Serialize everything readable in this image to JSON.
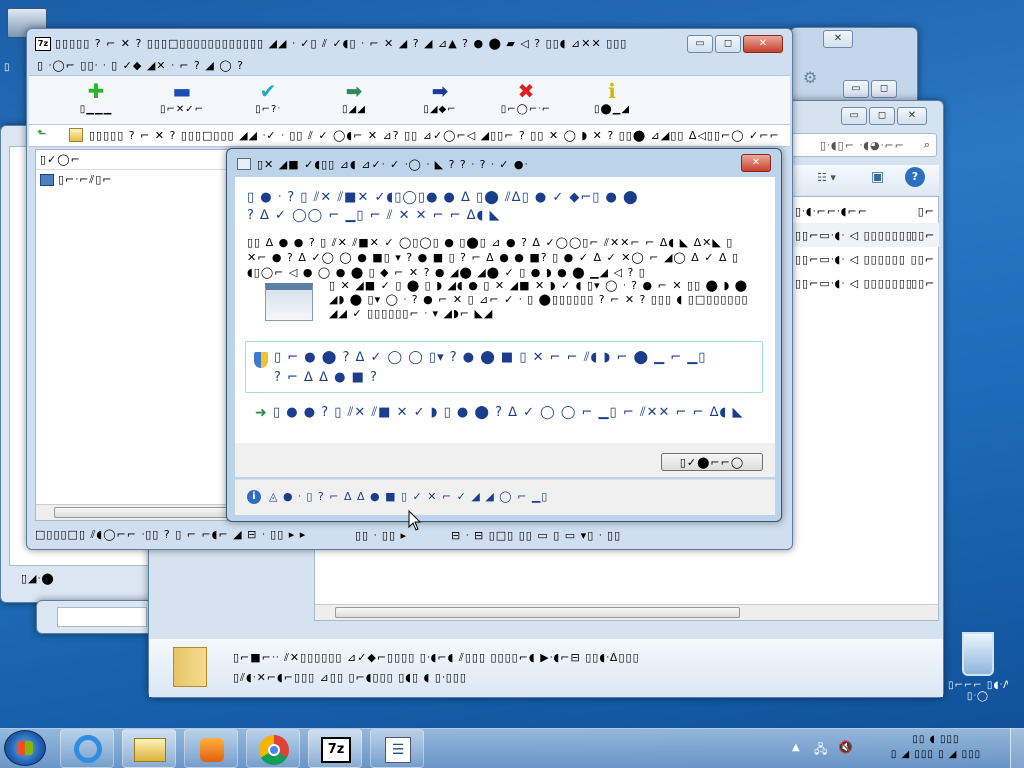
{
  "desktop": {
    "top_icon_label": "▯",
    "recycle_bin_label": "▯⌐⌐⌐ ▯◖ᐧᐱ▯",
    "recycle_bin_sub": "▯ᐧ◯"
  },
  "explorer_back": {
    "search": "▯ᐧ◖▯⌐ ᐧ◖◕ᐧ⌐⌐",
    "rows": [
      [
        "▯ᐧ◖ᐧ⌐⌐ᐧ◖⌐⌐",
        "▯⌐"
      ],
      [
        "▯▯⌐▭ᐧ◖ᐧ ◁ ▯▯▯▯▯▯▯",
        "▯▯⌐"
      ],
      [
        "▯▯⌐▭ᐧ◖ᐧ ◁ ▯▯▯▯▯▯",
        "▯▯⌐"
      ],
      [
        "▯▯⌐▭ᐧ◖ᐧ ◁ ▯▯▯▯▯▯▯",
        "▯▯⌐"
      ]
    ],
    "detail_line1": "▯⌐■⌐ᐧᐧ ⫽✕▯▯▯▯▯▯ ⊿✓◆⌐▯▯▯▯ ▯ᐧ◖⌐◖ ⫽▯▯▯ ▯▯▯▯⌐◖ ▶ᐧ◖⌐⊟ ▯▯◖ᐧᐃ▯▯▯",
    "detail_line2": "▯⫽◖ᐧ✕⌐◖⌐▯▯▯ ⊿▯▯ ▯⌐◖▯▯▯ ▯◖▯ ◖ ▯ᐧ▯▯▯",
    "left_label": "▯◢ᐧ⬤"
  },
  "sevenzip": {
    "title": "▯▯▯▯▯ ? ⌐ ✕ ? ▯▯▯□▯▯▯▯▯▯▯▯▯▯▯▯ ◢◢ ᐧ ✓▯ ⫽ ✓◖▯ ᐧ ⌐ ✕ ◢ ? ◢ ⊿▲ ? ● ⬤ ▰ ◁ ? ▯▯◖ ⊿✕✕ ▯▯▯",
    "menu": "▯ ᐧ◯⌐ ▯▯ᐧ ᐧ ▯ ✓◆ ◢✕ ᐧ ⌐ ? ◢ ◯ ?",
    "toolbar": [
      {
        "label": "▯▁▁▁",
        "color": "#2bb52b",
        "sym": "✚"
      },
      {
        "label": "▯⌐✕✓⌐",
        "color": "#1f4cb0",
        "sym": "▬"
      },
      {
        "label": "▯⌐?ᐧ",
        "color": "#2aa8c8",
        "sym": "✔"
      },
      {
        "label": "▯◢◢",
        "color": "#2b8a5a",
        "sym": "➡"
      },
      {
        "label": "▯◢◆⌐",
        "color": "#1b3aa0",
        "sym": "➡"
      },
      {
        "label": "▯⌐◯⌐ᐧ⌐",
        "color": "#e02020",
        "sym": "✖"
      },
      {
        "label": "▯⬤▁◢",
        "color": "#d8b400",
        "sym": "ℹ"
      }
    ],
    "address": "▯▯▯▯▯ ? ⌐ ✕ ? ▯▯▯□▯▯▯ ◢◢ ᐧ✓ ᐧ ▯▯ ⫽ ✓ ◯◖⌐ ✕ ⊿? ▯▯ ⊿✓◯⌐◁ ◢▯▯⌐ ? ▯▯ ✕ ◯ ◗ ✕ ? ▯▯⬤ ⊿◢▯▯ ᐃ◁▯▯⌐◯ ✓⌐⌐ ▯⌐✕ ▯▯▯ ⌐ ✕ ●",
    "left_header": "▯✓◯⌐",
    "left_item": "▯⌐ᐧ⌐⫽▯⌐",
    "status": [
      "□▯▯▯□▯ ⫽◖◯⌐⌐ ᐧ▯▯ ? ▯ ⌐ ⌐◖⌐ ◢ ⊟ ᐧ ▯▯ ▸ ▸",
      "▯▯ ᐧ ▯▯ ▸",
      "⊟ ᐧ ⊟ ▯□▯ ▯▯ ▭ ▯ ▭ ▾▯ ᐧ ▯▯"
    ]
  },
  "dialog": {
    "title": "▯✕ ◢■ ✓◖▯▯ ⊿◖ ⊿✓ᐧ ✓ ᐧ◯ ᐧ ◣ ? ? ᐧ ? ᐧ ✓ ●ᐧ",
    "heading": "▯ ● ᐧ ? ▯ ⫽✕ ⫽■✕ ✓◖▯◯▯● ● ᐃ ▯⬤ ⫽ᐃ▯ ● ✓ ◆⌐▯ ● ⬤ ? ᐃ ✓ ◯◯ ⌐ ▁▯ ⌐ ⫽ ✕ ✕ ⌐ ⌐ ᐃ◖ ◣",
    "body": "▯▯ ᐃ ● ● ? ▯ ⫽✕ ⫽■✕ ✓ ◯▯◯▯ ● ▯⬤▯ ⊿ ● ? ᐃ ✓◯◯▯⌐ ⫽✕✕⌐ ⌐ ᐃ◖ ◣ ᐃ✕◣ ▯ ✕⌐ ● ? ᐃ ✓◯ ◯ ● ■▯ ▾ ? ● ■ ▯ ? ⌐ ᐃ ● ● ■? ▯ ● ✓ ᐃ ✓ ✕◯ ⌐ ◢◯ ᐃ ✓ ᐃ ▯ ◖▯◯⌐ ◁ ● ◯ ● ⬤ ▯ ◆ ⌐ ✕ ? ● ◢⬤ ◢⬤ ✓ ▯ ● ◗ ● ⬤ ▁◢ ◁ ? ▯",
    "dlgpath": "▯ ✕ ◢■ ✓ ▯ ⬤ ▯ ◗ ◢◖ ● ▯ ✕ ◢■ ✕ ◗ ✓ ◖ ▯▾ ◯ ᐧ ? ● ⌐ ✕ ▯▯ ⬤ ◗ ⬤ ◢◗ ⬤ ▯▾ ◯ ᐧ ? ● ⌐ ✕ ▯ ⊿⌐ ✓ ᐧ ▯ ⬤▯▯▯▯▯▯ ? ⌐ ✕ ? ▯▯▯ ◖ ▯□▯▯▯▯▯▯ ◢◢ ✓ ▯▯▯▯▯▯⌐ ᐧ ▾ ◢◗⌐ ◣◢",
    "option1": "▯ ⌐ ● ⬤ ? ᐃ ✓ ◯ ◯ ▯▾ ? ● ⬤ ■ ▯ ✕ ⌐ ⌐ ⫽◖ ◗ ⌐ ⬤ ▁ ⌐ ▁▯",
    "option1b": "? ⌐ ᐃ ᐃ ● ■ ?",
    "option2": "▯ ● ● ? ▯ ⫽✕ ⫽■ ✕ ✓ ◗ ▯ ● ⬤ ? ᐃ ✓ ◯ ◯ ⌐ ▁▯ ⌐ ⫽✕✕ ⌐ ⌐ ᐃ◖ ◣",
    "cancel_button": "▯✓⬤⌐⌐◯",
    "footer": "◬ ● ᐧ ▯ ? ⌐ ᐃ ᐃ ● ■ ▯ ✓ ✕ ⌐ ✓ ◢ ◢ ◯ ⌐ ▁▯"
  },
  "taskbar": {
    "clock_time": "▯▯ ◖ ▯▯▯",
    "clock_date": "▯ ◢ ▯▯▯ ▯ ◢ ▯▯▯"
  }
}
